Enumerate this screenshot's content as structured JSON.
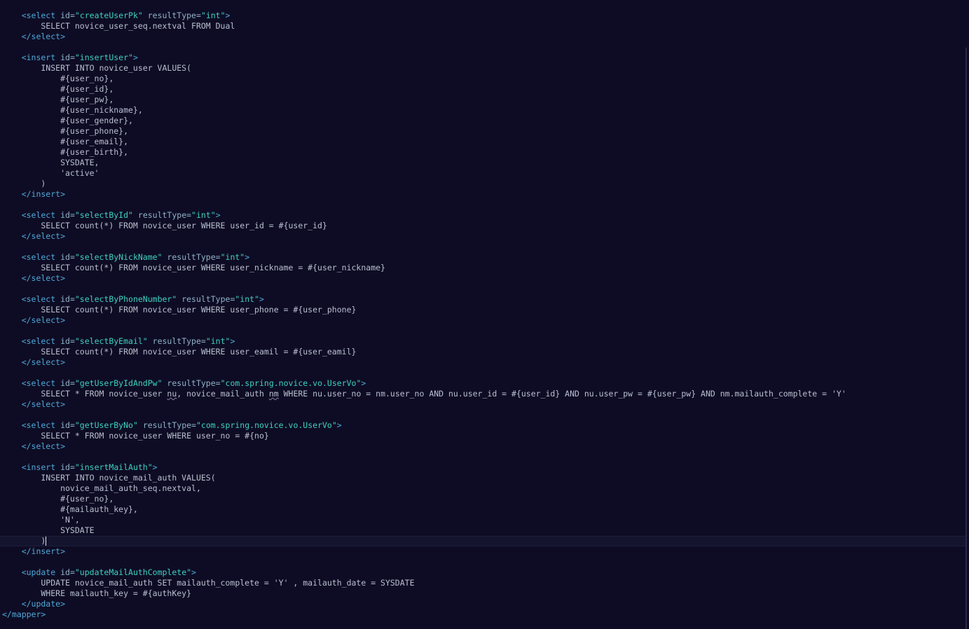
{
  "editor": {
    "current_line": 50,
    "lines": [
      [
        [
          "tag",
          "    <select "
        ],
        [
          "attr",
          "id="
        ],
        [
          "str",
          "\"createUserPk\""
        ],
        [
          "attr",
          " resultType="
        ],
        [
          "str",
          "\"int\""
        ],
        [
          "tag",
          ">"
        ]
      ],
      [
        [
          "txt",
          "        SELECT novice_user_seq.nextval FROM Dual"
        ]
      ],
      [
        [
          "tag",
          "    </select>"
        ]
      ],
      [],
      [
        [
          "tag",
          "    <insert "
        ],
        [
          "attr",
          "id="
        ],
        [
          "str",
          "\"insertUser\""
        ],
        [
          "tag",
          ">"
        ]
      ],
      [
        [
          "txt",
          "        INSERT INTO novice_user VALUES("
        ]
      ],
      [
        [
          "txt",
          "            #{user_no},"
        ]
      ],
      [
        [
          "txt",
          "            #{user_id},"
        ]
      ],
      [
        [
          "txt",
          "            #{user_pw},"
        ]
      ],
      [
        [
          "txt",
          "            #{user_nickname},"
        ]
      ],
      [
        [
          "txt",
          "            #{user_gender},"
        ]
      ],
      [
        [
          "txt",
          "            #{user_phone},"
        ]
      ],
      [
        [
          "txt",
          "            #{user_email},"
        ]
      ],
      [
        [
          "txt",
          "            #{user_birth},"
        ]
      ],
      [
        [
          "txt",
          "            SYSDATE,"
        ]
      ],
      [
        [
          "txt",
          "            'active'"
        ]
      ],
      [
        [
          "txt",
          "        )"
        ]
      ],
      [
        [
          "tag",
          "    </insert>"
        ]
      ],
      [],
      [
        [
          "tag",
          "    <select "
        ],
        [
          "attr",
          "id="
        ],
        [
          "str",
          "\"selectById\""
        ],
        [
          "attr",
          " resultType="
        ],
        [
          "str",
          "\"int\""
        ],
        [
          "tag",
          ">"
        ]
      ],
      [
        [
          "txt",
          "        SELECT count(*) FROM novice_user WHERE user_id = #{user_id}"
        ]
      ],
      [
        [
          "tag",
          "    </select>"
        ]
      ],
      [],
      [
        [
          "tag",
          "    <select "
        ],
        [
          "attr",
          "id="
        ],
        [
          "str",
          "\"selectByNickName\""
        ],
        [
          "attr",
          " resultType="
        ],
        [
          "str",
          "\"int\""
        ],
        [
          "tag",
          ">"
        ]
      ],
      [
        [
          "txt",
          "        SELECT count(*) FROM novice_user WHERE user_nickname = #{user_nickname}"
        ]
      ],
      [
        [
          "tag",
          "    </select>"
        ]
      ],
      [],
      [
        [
          "tag",
          "    <select "
        ],
        [
          "attr",
          "id="
        ],
        [
          "str",
          "\"selectByPhoneNumber\""
        ],
        [
          "attr",
          " resultType="
        ],
        [
          "str",
          "\"int\""
        ],
        [
          "tag",
          ">"
        ]
      ],
      [
        [
          "txt",
          "        SELECT count(*) FROM novice_user WHERE user_phone = #{user_phone}"
        ]
      ],
      [
        [
          "tag",
          "    </select>"
        ]
      ],
      [],
      [
        [
          "tag",
          "    <select "
        ],
        [
          "attr",
          "id="
        ],
        [
          "str",
          "\"selectByEmail\""
        ],
        [
          "attr",
          " resultType="
        ],
        [
          "str",
          "\"int\""
        ],
        [
          "tag",
          ">"
        ]
      ],
      [
        [
          "txt",
          "        SELECT count(*) FROM novice_user WHERE user_eamil = #{user_eamil}"
        ]
      ],
      [
        [
          "tag",
          "    </select>"
        ]
      ],
      [],
      [
        [
          "tag",
          "    <select "
        ],
        [
          "attr",
          "id="
        ],
        [
          "str",
          "\"getUserByIdAndPw\""
        ],
        [
          "attr",
          " resultType="
        ],
        [
          "str",
          "\"com.spring.novice.vo.UserVo\""
        ],
        [
          "tag",
          ">"
        ]
      ],
      [
        [
          "txt",
          "        SELECT * FROM novice_user "
        ],
        [
          "squig",
          "nu"
        ],
        [
          "txt",
          ", novice_mail_auth "
        ],
        [
          "squig",
          "nm"
        ],
        [
          "txt",
          " WHERE nu.user_no = nm.user_no AND nu.user_id = #{user_id} AND nu.user_pw = #{user_pw} AND nm.mailauth_complete = 'Y'"
        ]
      ],
      [
        [
          "tag",
          "    </select>"
        ]
      ],
      [],
      [
        [
          "tag",
          "    <select "
        ],
        [
          "attr",
          "id="
        ],
        [
          "str",
          "\"getUserByNo\""
        ],
        [
          "attr",
          " resultType="
        ],
        [
          "str",
          "\"com.spring.novice.vo.UserVo\""
        ],
        [
          "tag",
          ">"
        ]
      ],
      [
        [
          "txt",
          "        SELECT * FROM novice_user WHERE user_no = #{no}"
        ]
      ],
      [
        [
          "tag",
          "    </select>"
        ]
      ],
      [],
      [
        [
          "tag",
          "    <insert "
        ],
        [
          "attr",
          "id="
        ],
        [
          "str",
          "\"insertMailAuth\""
        ],
        [
          "tag",
          ">"
        ]
      ],
      [
        [
          "txt",
          "        INSERT INTO novice_mail_auth VALUES("
        ]
      ],
      [
        [
          "txt",
          "            novice_mail_auth_seq.nextval,"
        ]
      ],
      [
        [
          "txt",
          "            #{user_no},"
        ]
      ],
      [
        [
          "txt",
          "            #{mailauth_key},"
        ]
      ],
      [
        [
          "txt",
          "            'N',"
        ]
      ],
      [
        [
          "txt",
          "            SYSDATE"
        ]
      ],
      [
        [
          "txt",
          "        )"
        ]
      ],
      [
        [
          "tag",
          "    </insert>"
        ]
      ],
      [],
      [
        [
          "tag",
          "    <update "
        ],
        [
          "attr",
          "id="
        ],
        [
          "str",
          "\"updateMailAuthComplete\""
        ],
        [
          "tag",
          ">"
        ]
      ],
      [
        [
          "txt",
          "        UPDATE novice_mail_auth SET mailauth_complete = 'Y' , mailauth_date = SYSDATE"
        ]
      ],
      [
        [
          "txt",
          "        WHERE mailauth_key = #{authKey}"
        ]
      ],
      [
        [
          "tag",
          "    </update>"
        ]
      ],
      [
        [
          "tag",
          "</mapper>"
        ]
      ]
    ]
  }
}
